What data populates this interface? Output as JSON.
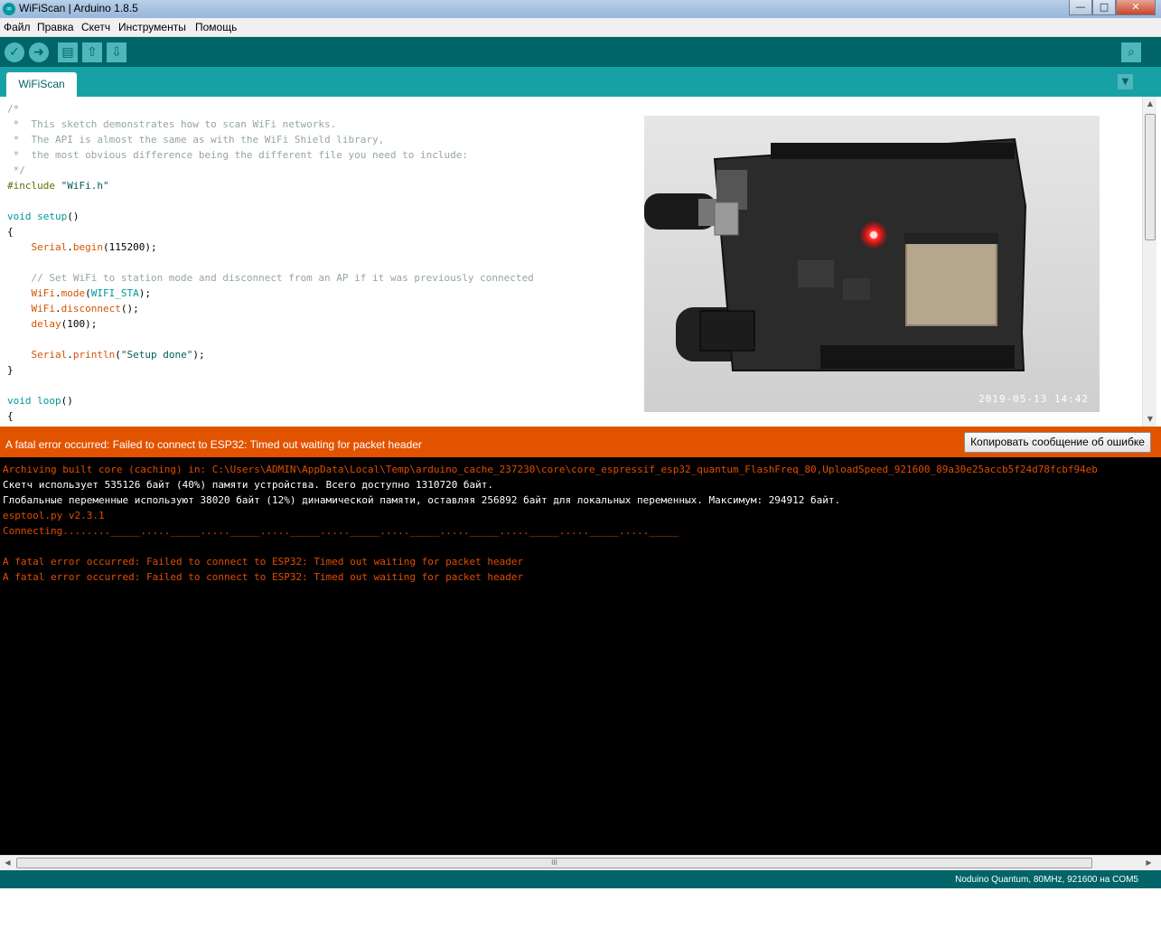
{
  "window": {
    "title": "WiFiScan | Arduino 1.8.5",
    "app_icon": "arduino-logo-icon",
    "buttons": {
      "minimize": "—",
      "maximize": "□",
      "close": "✕"
    }
  },
  "menu": [
    "Файл",
    "Правка",
    "Скетч",
    "Инструменты",
    "Помощь"
  ],
  "toolbar": {
    "verify_icon": "✓",
    "upload_icon": "➜",
    "new_icon": "▤",
    "open_icon": "⇧",
    "save_icon": "⇩",
    "serial_monitor_icon": "⌕"
  },
  "tabs": {
    "active": "WiFiScan",
    "menu_icon": "▼"
  },
  "editor": {
    "code_lines": [
      [
        {
          "t": "/*",
          "c": "c-comment"
        }
      ],
      [
        {
          "t": " *  This sketch demonstrates how to scan WiFi networks.",
          "c": "c-comment"
        }
      ],
      [
        {
          "t": " *  The API is almost the same as with the WiFi Shield library,",
          "c": "c-comment"
        }
      ],
      [
        {
          "t": " *  the most obvious difference being the different file you need to include:",
          "c": "c-comment"
        }
      ],
      [
        {
          "t": " */",
          "c": "c-comment"
        }
      ],
      [
        {
          "t": "#include ",
          "c": "c-pre"
        },
        {
          "t": "\"WiFi.h\"",
          "c": "c-str"
        }
      ],
      [
        {
          "t": "",
          "c": ""
        }
      ],
      [
        {
          "t": "void",
          "c": "c-type"
        },
        {
          "t": " ",
          "c": ""
        },
        {
          "t": "setup",
          "c": "c-type"
        },
        {
          "t": "()",
          "c": ""
        }
      ],
      [
        {
          "t": "{",
          "c": ""
        }
      ],
      [
        {
          "t": "    ",
          "c": ""
        },
        {
          "t": "Serial",
          "c": "c-fn"
        },
        {
          "t": ".",
          "c": ""
        },
        {
          "t": "begin",
          "c": "c-fn"
        },
        {
          "t": "(115200);",
          "c": ""
        }
      ],
      [
        {
          "t": "",
          "c": ""
        }
      ],
      [
        {
          "t": "    // Set WiFi to station mode and disconnect from an AP if it was previously connected",
          "c": "c-comment"
        }
      ],
      [
        {
          "t": "    ",
          "c": ""
        },
        {
          "t": "WiFi",
          "c": "c-fn"
        },
        {
          "t": ".",
          "c": ""
        },
        {
          "t": "mode",
          "c": "c-fn"
        },
        {
          "t": "(",
          "c": ""
        },
        {
          "t": "WIFI_STA",
          "c": "c-type"
        },
        {
          "t": ");",
          "c": ""
        }
      ],
      [
        {
          "t": "    ",
          "c": ""
        },
        {
          "t": "WiFi",
          "c": "c-fn"
        },
        {
          "t": ".",
          "c": ""
        },
        {
          "t": "disconnect",
          "c": "c-fn"
        },
        {
          "t": "();",
          "c": ""
        }
      ],
      [
        {
          "t": "    ",
          "c": ""
        },
        {
          "t": "delay",
          "c": "c-fn"
        },
        {
          "t": "(100);",
          "c": ""
        }
      ],
      [
        {
          "t": "",
          "c": ""
        }
      ],
      [
        {
          "t": "    ",
          "c": ""
        },
        {
          "t": "Serial",
          "c": "c-fn"
        },
        {
          "t": ".",
          "c": ""
        },
        {
          "t": "println",
          "c": "c-fn"
        },
        {
          "t": "(",
          "c": ""
        },
        {
          "t": "\"Setup done\"",
          "c": "c-str"
        },
        {
          "t": ");",
          "c": ""
        }
      ],
      [
        {
          "t": "}",
          "c": ""
        }
      ],
      [
        {
          "t": "",
          "c": ""
        }
      ],
      [
        {
          "t": "void",
          "c": "c-type"
        },
        {
          "t": " ",
          "c": ""
        },
        {
          "t": "loop",
          "c": "c-type"
        },
        {
          "t": "()",
          "c": ""
        }
      ],
      [
        {
          "t": "{",
          "c": ""
        }
      ]
    ],
    "photo_stamp": "2019-05-13 14:42"
  },
  "error_bar": {
    "message": "A fatal error occurred: Failed to connect to ESP32: Timed out waiting for packet header",
    "copy_button": "Копировать сообщение об ошибке"
  },
  "console": {
    "lines": [
      {
        "text": "Archiving built core (caching) in: C:\\Users\\ADMIN\\AppData\\Local\\Temp\\arduino_cache_237230\\core\\core_espressif_esp32_quantum_FlashFreq_80,UploadSpeed_921600_89a30e25accb5f24d78fcbf94eb",
        "color": "red"
      },
      {
        "text": "Скетч использует 535126 байт (40%) памяти устройства. Всего доступно 1310720 байт.",
        "color": "white"
      },
      {
        "text": "Глобальные переменные используют 38020 байт (12%) динамической памяти, оставляя 256892 байт для локальных переменных. Максимум: 294912 байт.",
        "color": "white"
      },
      {
        "text": "esptool.py v2.3.1",
        "color": "red"
      },
      {
        "text": "Connecting........_____....._____....._____....._____....._____....._____....._____....._____....._____....._____",
        "color": "red"
      },
      {
        "text": "",
        "color": "red"
      },
      {
        "text": "A fatal error occurred: Failed to connect to ESP32: Timed out waiting for packet header",
        "color": "red"
      },
      {
        "text": "A fatal error occurred: Failed to connect to ESP32: Timed out waiting for packet header",
        "color": "red"
      }
    ],
    "hscroll_grip": "III"
  },
  "status": {
    "board": "Noduino Quantum, 80MHz, 921600 на COM5"
  },
  "colors": {
    "toolbar": "#006468",
    "tabbar": "#17a1a5",
    "error": "#e25300",
    "console_red": "#e34c00"
  }
}
